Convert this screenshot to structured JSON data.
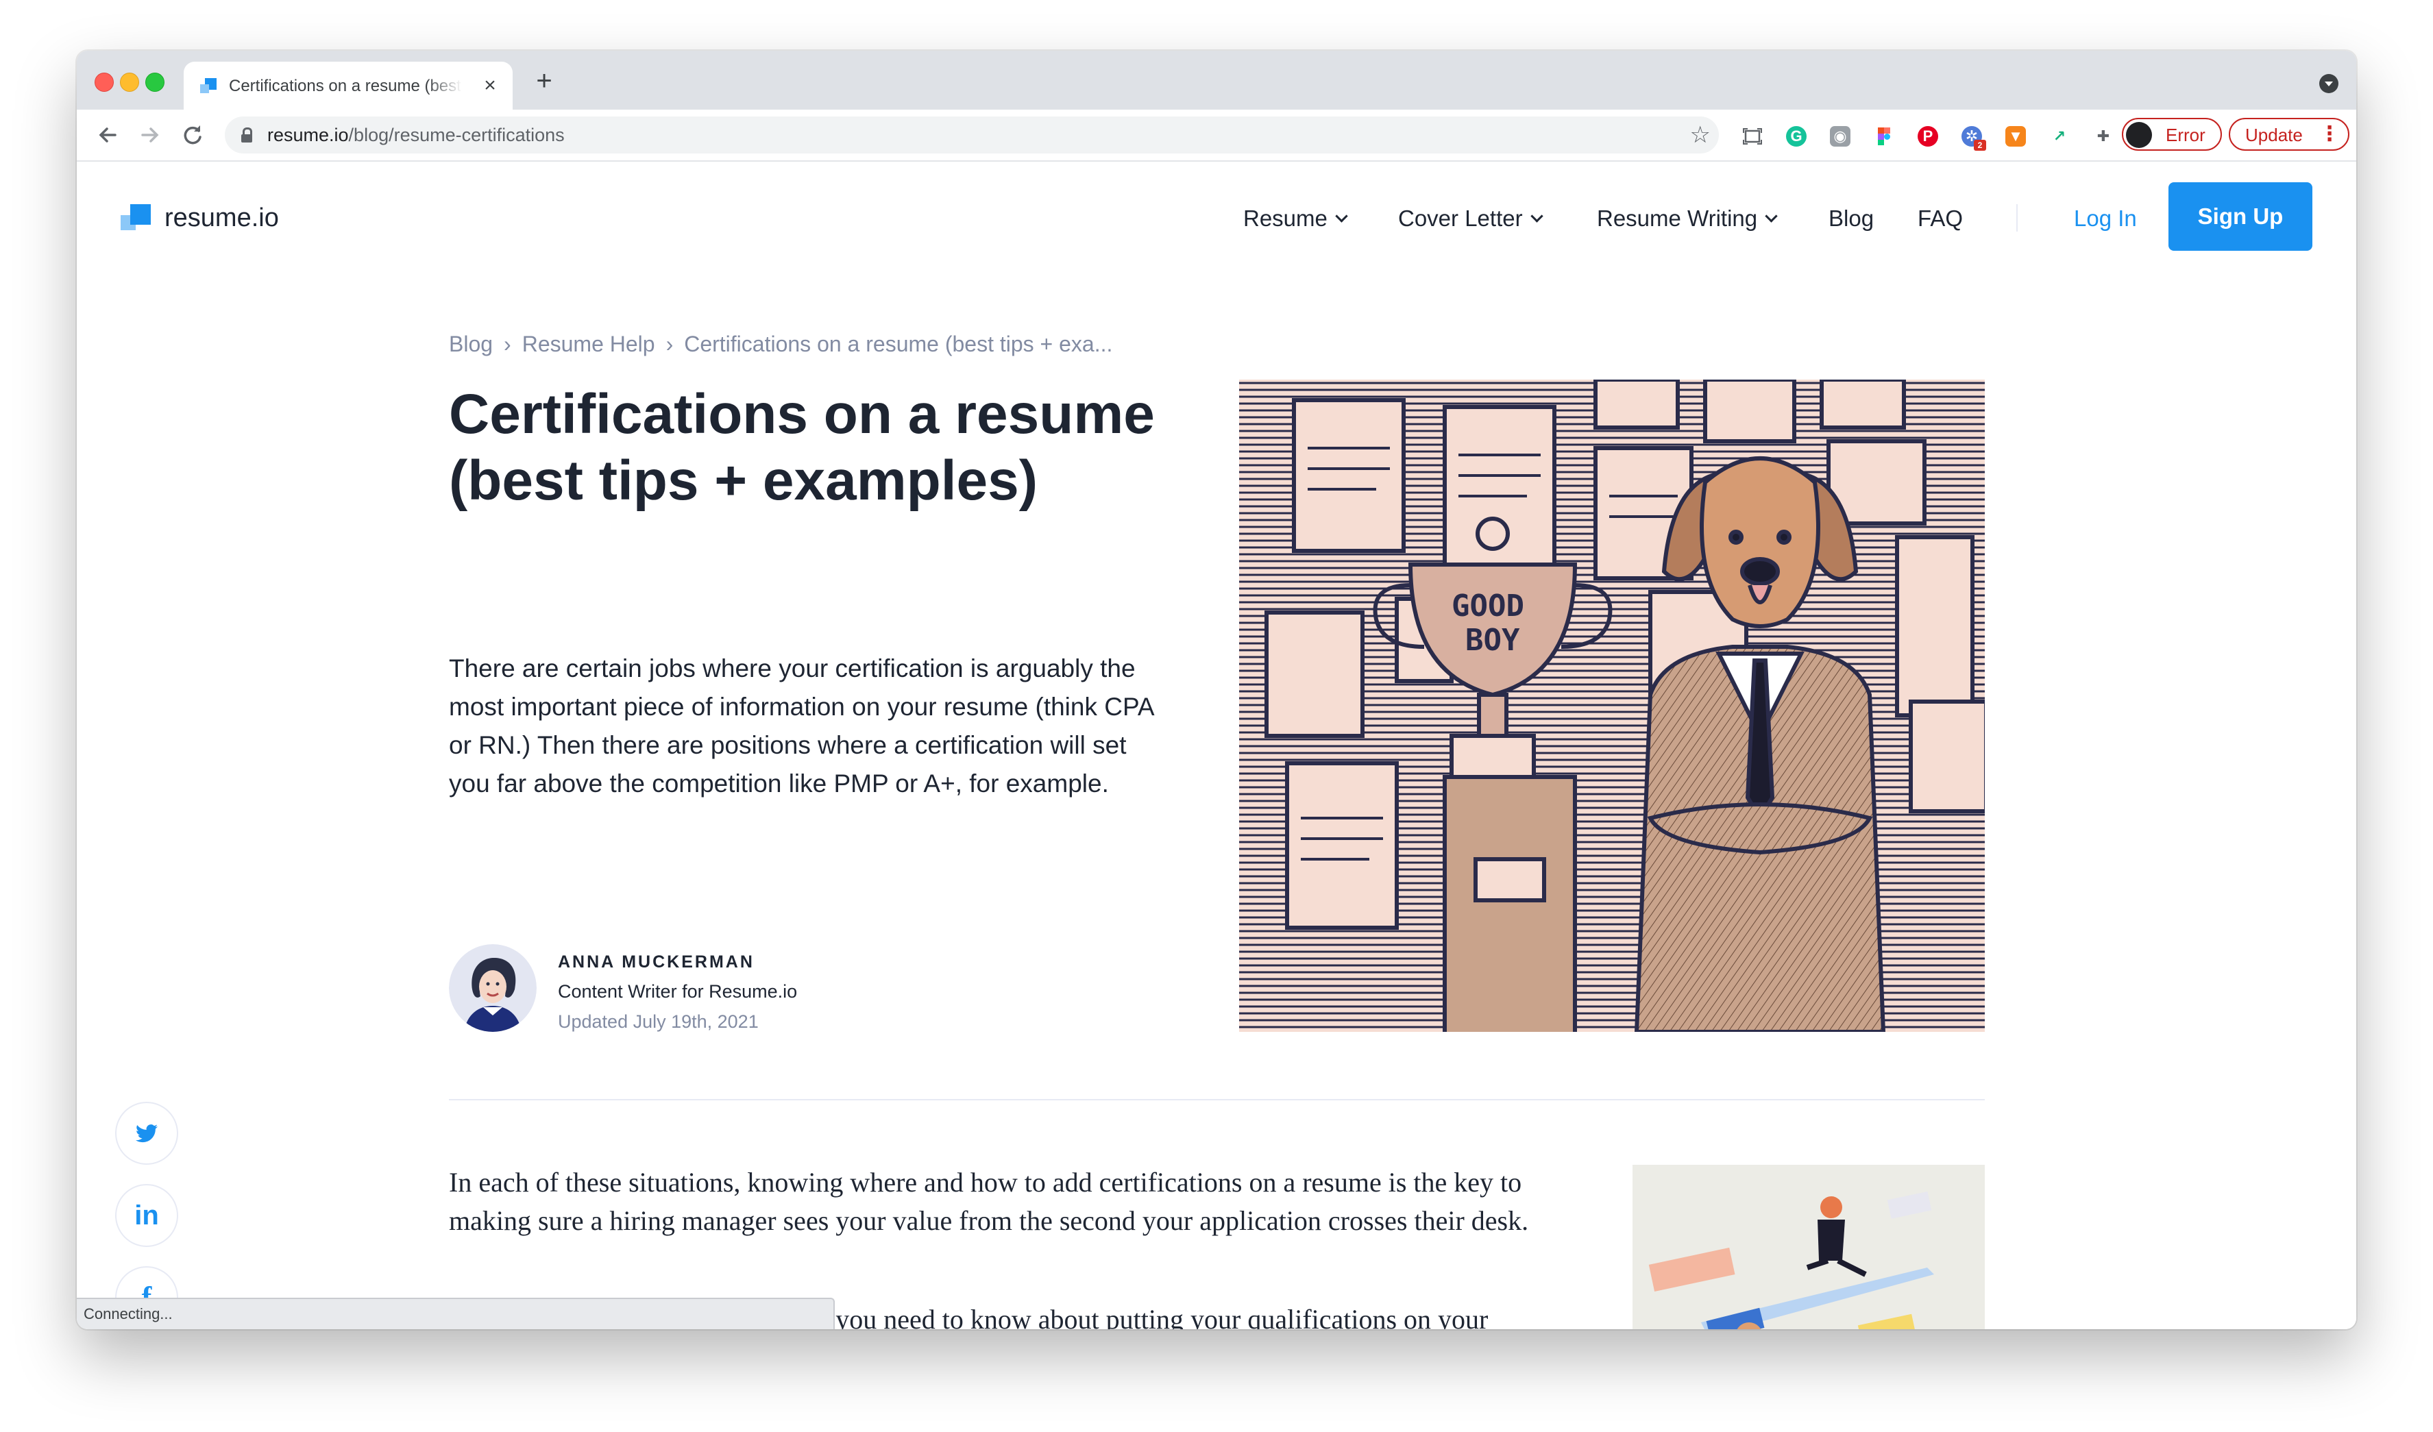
{
  "browser": {
    "tab_title": "Certifications on a resume (best tips + examples)",
    "tab_close": "×",
    "new_tab": "+",
    "url_host": "resume.io",
    "url_path": "/blog/resume-certifications",
    "error_label": "Error",
    "update_label": "Update",
    "extension_badge": "2",
    "nav_icons": [
      "back-arrow-icon",
      "forward-arrow-icon",
      "reload-icon"
    ],
    "extension_icons": [
      "screenshot-icon",
      "grammarly-icon",
      "camera-icon",
      "figma-icon",
      "pinterest-icon",
      "sparkle-extension-icon",
      "metamask-fox-icon",
      "bird-extension-icon",
      "puzzle-extensions-icon"
    ]
  },
  "site": {
    "logo_text": "resume.io",
    "nav": {
      "resume": "Resume",
      "cover_letter": "Cover Letter",
      "resume_writing": "Resume Writing",
      "blog": "Blog",
      "faq": "FAQ",
      "login": "Log In",
      "signup": "Sign Up"
    },
    "accent_color": "#1a91f0"
  },
  "article": {
    "breadcrumb": [
      "Blog",
      "Resume Help",
      "Certifications on a resume (best tips + exa..."
    ],
    "breadcrumb_separator": "›",
    "title": "Certifications on a resume (best tips + examples)",
    "lead": "There are certain jobs where your certification is arguably the most important piece of information on your resume (think CPA or RN.) Then there are positions where a certification will set you far above the competition like PMP or A+, for example.",
    "author": {
      "name": "ANNA MUCKERMAN",
      "role": "Content Writer for Resume.io",
      "updated": "Updated July 19th, 2021"
    },
    "hero_trophy_text": [
      "GOOD",
      "BOY"
    ],
    "body": [
      "In each of these situations, knowing where and how to add certifications on a resume is the key to making sure a hiring manager sees your value from the second your application crosses their desk.",
      "In this blog we’ll cover everything you need to know about putting your qualifications on your resume. Here are the topics:"
    ]
  },
  "share": [
    "twitter-icon",
    "linkedin-icon",
    "facebook-icon"
  ],
  "share_glyphs": {
    "linkedin": "in",
    "facebook": "f"
  },
  "status_bar": "Connecting..."
}
